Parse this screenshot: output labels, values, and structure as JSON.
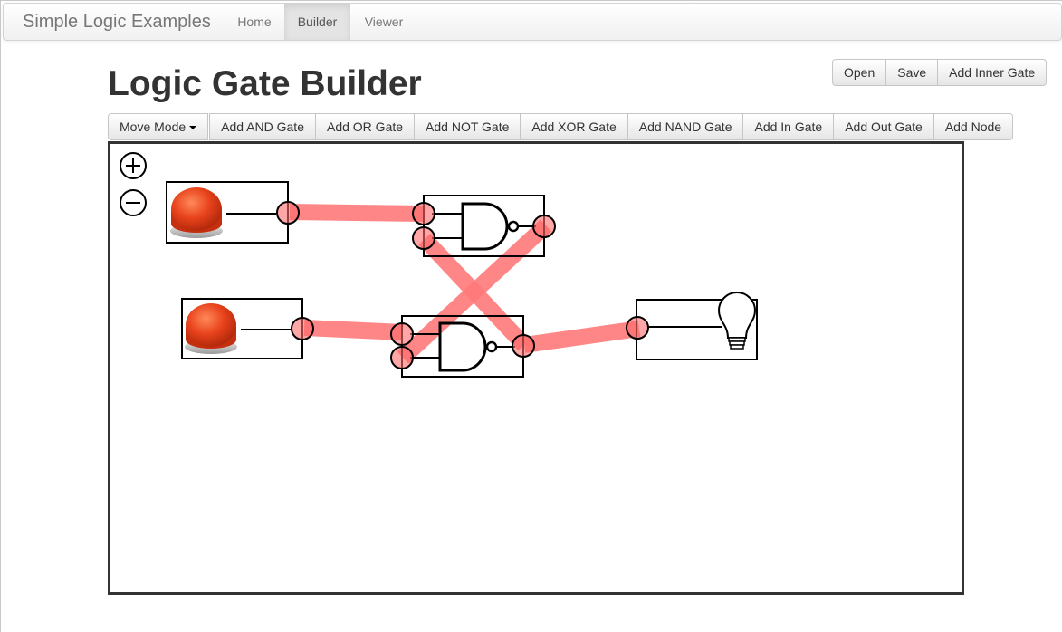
{
  "navbar": {
    "brand": "Simple Logic Examples",
    "items": [
      {
        "label": "Home",
        "active": false
      },
      {
        "label": "Builder",
        "active": true
      },
      {
        "label": "Viewer",
        "active": false
      }
    ]
  },
  "page": {
    "title": "Logic Gate Builder"
  },
  "file_actions": {
    "open": "Open",
    "save": "Save",
    "add_inner_gate": "Add Inner Gate"
  },
  "toolbar": {
    "mode": "Move Mode",
    "add_and": "Add AND Gate",
    "add_or": "Add OR Gate",
    "add_not": "Add NOT Gate",
    "add_xor": "Add XOR Gate",
    "add_nand": "Add NAND Gate",
    "add_in": "Add In Gate",
    "add_out": "Add Out Gate",
    "add_node": "Add Node"
  },
  "canvas": {
    "zoom_in_icon": "plus-circle-icon",
    "zoom_out_icon": "minus-circle-icon",
    "components": [
      {
        "type": "input-button",
        "icon": "red-push-button-icon"
      },
      {
        "type": "input-button",
        "icon": "red-push-button-icon"
      },
      {
        "type": "nand-gate",
        "icon": "nand-gate-icon"
      },
      {
        "type": "nand-gate",
        "icon": "nand-gate-icon"
      },
      {
        "type": "output-bulb",
        "icon": "light-bulb-icon"
      }
    ],
    "wire_color": "#ff6b6b",
    "wire_state": "active"
  },
  "colors": {
    "wire": "#ff7a7a",
    "button_red": "#e8431c",
    "border": "#333333"
  }
}
